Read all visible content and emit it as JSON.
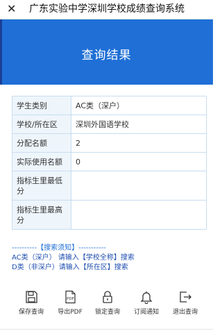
{
  "topbar": {
    "close_symbol": "✕",
    "title": "广东实验中学深圳学校成绩查询系统"
  },
  "banner": {
    "title": "查询结果",
    "color": "#1f6fd6"
  },
  "results": {
    "rows": [
      {
        "label": "学生类别",
        "value": "AC类（深户）"
      },
      {
        "label": "学校/所在区",
        "value": "深圳外国语学校"
      },
      {
        "label": "分配名额",
        "value": "2"
      },
      {
        "label": "实际使用名额",
        "value": "0"
      },
      {
        "label": "指标生里最低分",
        "value": ""
      },
      {
        "label": "指标生里最高分",
        "value": ""
      }
    ]
  },
  "tips": {
    "heading": "----------【搜索须知】-----------",
    "line1": "AC类（深户）  请输入【学校全称】搜索",
    "line2": "D类（非深户）请输入【所在区】搜索"
  },
  "actions": [
    {
      "label": "保存查询",
      "icon": "save-icon"
    },
    {
      "label": "导出PDF",
      "icon": "pdf-icon",
      "icon_text": "PDF"
    },
    {
      "label": "锁定查询",
      "icon": "lock-icon"
    },
    {
      "label": "订阅通知",
      "icon": "bell-icon"
    },
    {
      "label": "退出查询",
      "icon": "exit-icon"
    }
  ]
}
